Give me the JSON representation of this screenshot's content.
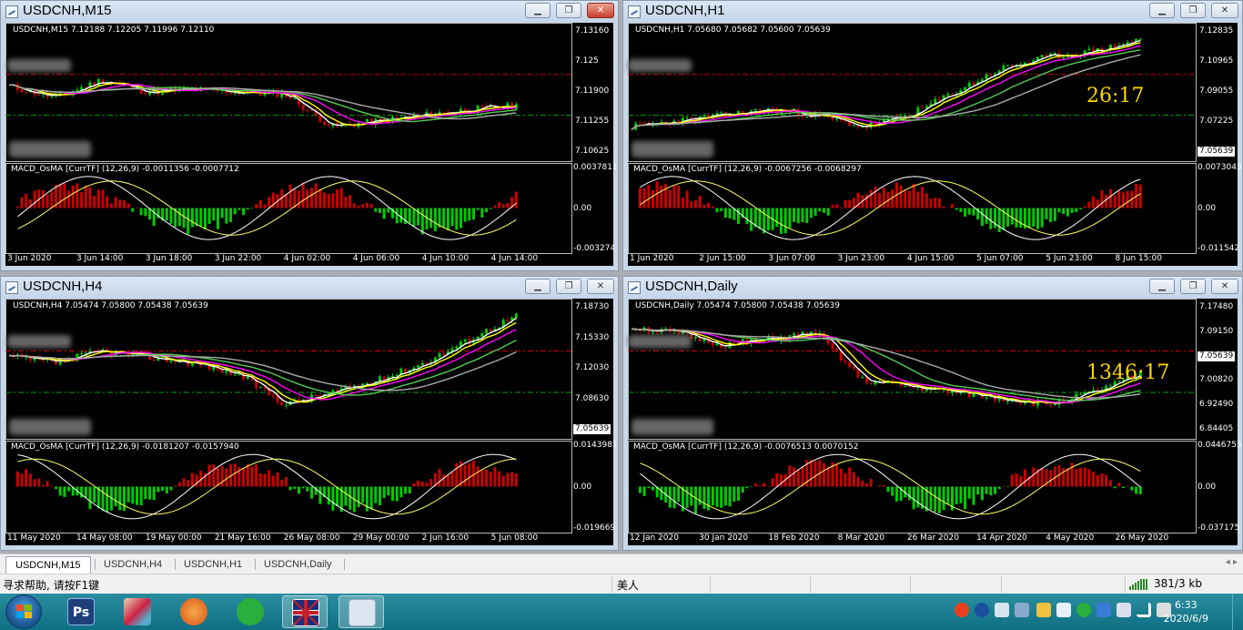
{
  "windows": [
    {
      "id": "m15",
      "title": "USDCNH,M15",
      "ohlc": "USDCNH,M15  7.12188 7.12205 7.11996 7.12110",
      "macd": "MACD_OsMA [CurrTF] (12,26,9) -0.0011356 -0.0007712",
      "y_ticks": [
        "7.13160",
        "7.125",
        "7.11900",
        "7.11255",
        "7.10625"
      ],
      "current_price": "7.12110",
      "macd_ticks": [
        "0.0037811",
        "0.00",
        "-0.003274"
      ],
      "x_ticks": [
        "3 Jun 2020",
        "3 Jun 14:00",
        "3 Jun 18:00",
        "3 Jun 22:00",
        "4 Jun 02:00",
        "4 Jun 06:00",
        "4 Jun 10:00",
        "4 Jun 14:00"
      ],
      "active": true,
      "countdown": ""
    },
    {
      "id": "h1",
      "title": "USDCNH,H1",
      "ohlc": "USDCNH,H1  7.05680 7.05682 7.05600 7.05639",
      "macd": "MACD_OsMA [CurrTF] (12,26,9) -0.0067256 -0.0068297",
      "y_ticks": [
        "7.12835",
        "7.10965",
        "7.09055",
        "7.07225",
        "7.05639"
      ],
      "current_price": "7.05639",
      "macd_ticks": [
        "0.0073043",
        "0.00",
        "-0.011542"
      ],
      "x_ticks": [
        "1 Jun 2020",
        "2 Jun 15:00",
        "3 Jun 07:00",
        "3 Jun 23:00",
        "4 Jun 15:00",
        "5 Jun 07:00",
        "5 Jun 23:00",
        "8 Jun 15:00"
      ],
      "active": false,
      "countdown": "26:17"
    },
    {
      "id": "h4",
      "title": "USDCNH,H4",
      "ohlc": "USDCNH,H4  7.05474 7.05800 7.05438 7.05639",
      "macd": "MACD_OsMA [CurrTF] (12,26,9) -0.0181207 -0.0157940",
      "y_ticks": [
        "7.18730",
        "7.15330",
        "7.12030",
        "7.08630",
        "7.05639"
      ],
      "current_price": "7.05639",
      "macd_ticks": [
        "0.0143981",
        "0.00",
        "-0.019669"
      ],
      "x_ticks": [
        "11 May 2020",
        "14 May 08:00",
        "19 May 00:00",
        "21 May 16:00",
        "26 May 08:00",
        "29 May 00:00",
        "2 Jun 16:00",
        "5 Jun 08:00"
      ],
      "active": false,
      "countdown": ""
    },
    {
      "id": "daily",
      "title": "USDCNH,Daily",
      "ohlc": "USDCNH,Daily  7.05474 7.05800 7.05438 7.05639",
      "macd": "MACD_OsMA [CurrTF] (12,26,9) -0.0076513 0.0070152",
      "y_ticks": [
        "7.17480",
        "7.09150",
        "7.05639",
        "7.00820",
        "6.92490",
        "6.84405"
      ],
      "current_price": "7.05639",
      "macd_ticks": [
        "0.0446755",
        "0.00",
        "-0.037175"
      ],
      "x_ticks": [
        "12 Jan 2020",
        "30 Jan 2020",
        "18 Feb 2020",
        "8 Mar 2020",
        "26 Mar 2020",
        "14 Apr 2020",
        "4 May 2020",
        "26 May 2020"
      ],
      "active": false,
      "countdown": "1346:17"
    }
  ],
  "tabs": [
    "USDCNH,M15",
    "USDCNH,H4",
    "USDCNH,H1",
    "USDCNH,Daily"
  ],
  "active_tab": "USDCNH,M15",
  "status": {
    "help": "寻求帮助, 请按F1键",
    "profile": "美人",
    "connection": "381/3 kb"
  },
  "clock": {
    "time": "6:33",
    "date": "2020/6/9"
  },
  "taskbar_apps": [
    {
      "name": "photoshop",
      "label": "Ps",
      "color": "#1f3f7a"
    },
    {
      "name": "pinball",
      "label": "",
      "color": "#d9c9a8"
    },
    {
      "name": "foxmail",
      "label": "",
      "color": "#e8782a"
    },
    {
      "name": "wechat",
      "label": "",
      "color": "#2aae3c"
    },
    {
      "name": "mt4",
      "label": "",
      "color": "#c8202a"
    },
    {
      "name": "tool",
      "label": "",
      "color": "#c8d8e8"
    }
  ],
  "colors": {
    "bull": "#00cc00",
    "bear": "#cc0000",
    "ma_fast": "#ffffff",
    "ma_yellow": "#ffff00",
    "ma_magenta": "#ff00ff",
    "ma_green": "#55cc55",
    "ma_gray": "#aaaaaa"
  }
}
